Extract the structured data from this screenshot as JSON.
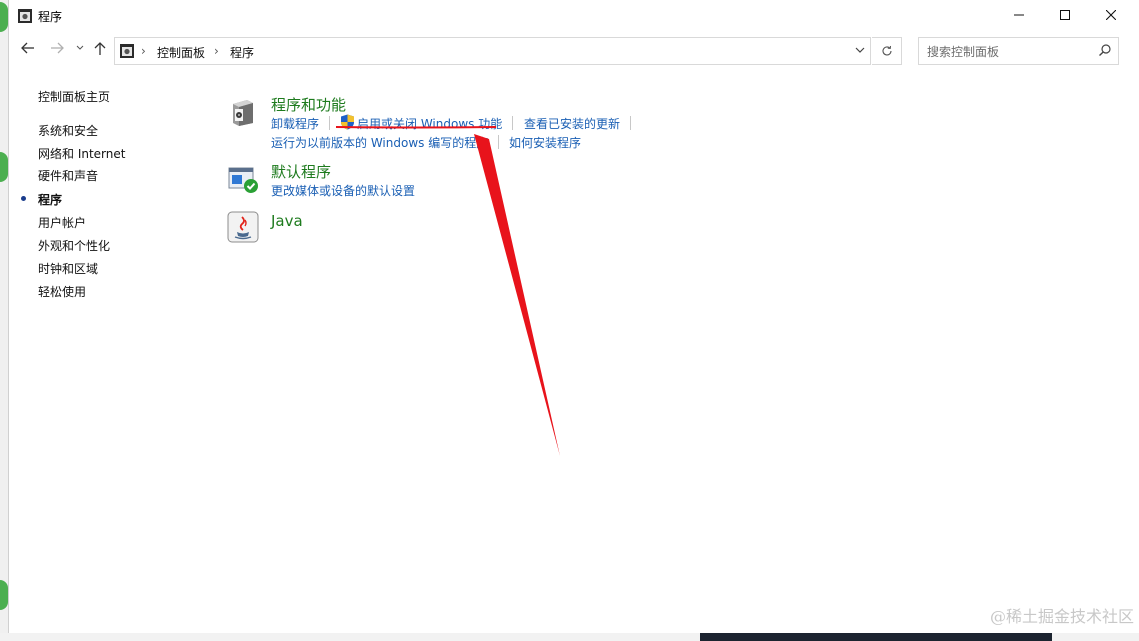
{
  "window": {
    "title": "程序",
    "controls": {
      "minimize": "—",
      "maximize": "☐",
      "close": "✕"
    }
  },
  "address": {
    "breadcrumbs": [
      "控制面板",
      "程序"
    ],
    "search_placeholder": "搜索控制面板"
  },
  "sidebar": {
    "home": "控制面板主页",
    "items": [
      {
        "label": "系统和安全"
      },
      {
        "label": "网络和 Internet"
      },
      {
        "label": "硬件和声音"
      },
      {
        "label": "程序",
        "active": true
      },
      {
        "label": "用户帐户"
      },
      {
        "label": "外观和个性化"
      },
      {
        "label": "时钟和区域"
      },
      {
        "label": "轻松使用"
      }
    ]
  },
  "categories": {
    "programs_features": {
      "title": "程序和功能",
      "links": [
        "卸载程序",
        "启用或关闭 Windows 功能",
        "查看已安装的更新",
        "运行为以前版本的 Windows 编写的程序",
        "如何安装程序"
      ]
    },
    "default_programs": {
      "title": "默认程序",
      "links": [
        "更改媒体或设备的默认设置"
      ]
    },
    "java": {
      "title": "Java"
    }
  },
  "annotation": {
    "color": "#e8131b"
  },
  "watermark": "@稀土掘金技术社区",
  "colors": {
    "link": "#1a5fb4",
    "category_title": "#1e7b1e",
    "active_bullet": "#1a3c8c"
  }
}
